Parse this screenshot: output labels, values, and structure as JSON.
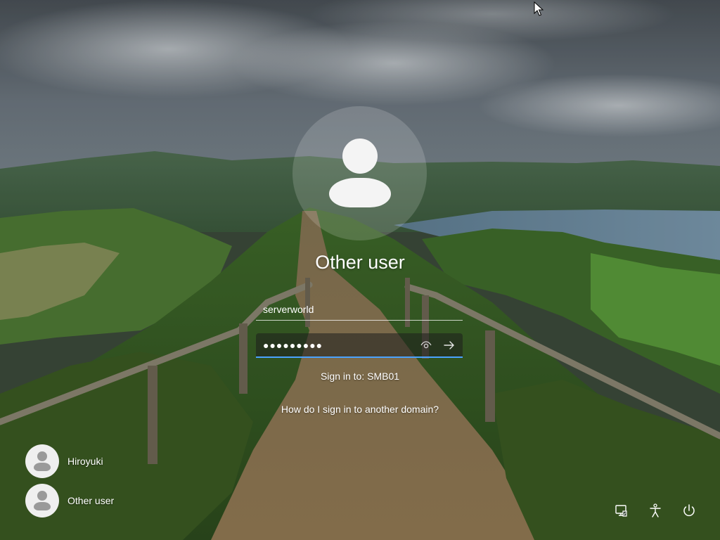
{
  "login": {
    "title": "Other user",
    "username_value": "serverworld",
    "password_masked": "●●●●●●●●●",
    "signin_to": "Sign in to: SMB01",
    "other_domain_link": "How do I sign in to another domain?"
  },
  "users": [
    {
      "name": "Hiroyuki"
    },
    {
      "name": "Other user"
    }
  ],
  "tray": {
    "network_icon": "network-icon",
    "accessibility_icon": "accessibility-icon",
    "power_icon": "power-icon"
  },
  "colors": {
    "focus_underline": "#4aa3ff"
  }
}
